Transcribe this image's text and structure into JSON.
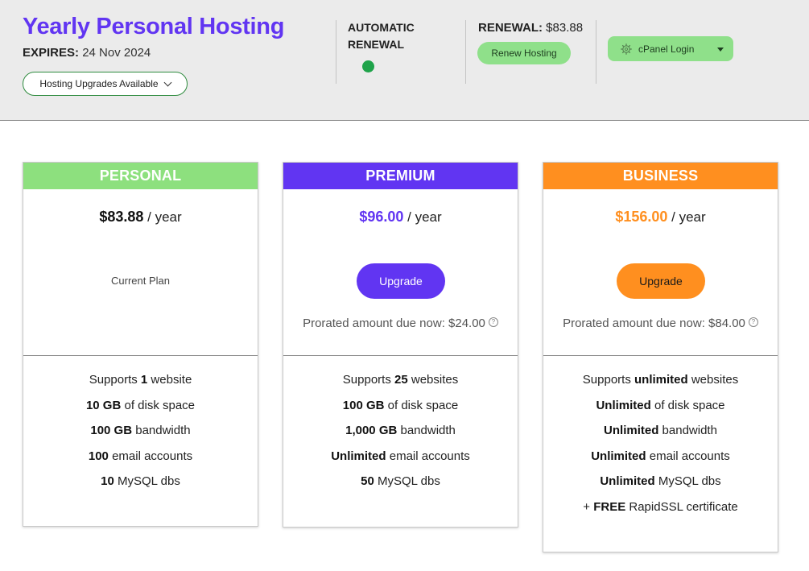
{
  "header": {
    "title": "Yearly Personal Hosting",
    "expires_label": "EXPIRES:",
    "expires_value": "24 Nov 2024",
    "upgrades_button": "Hosting Upgrades Available",
    "auto_renewal_label_1": "AUTOMATIC",
    "auto_renewal_label_2": "RENEWAL",
    "auto_renewal_status_color": "#1fa34a",
    "renewal_label": "RENEWAL:",
    "renewal_value": "$83.88",
    "renew_button": "Renew Hosting",
    "cpanel_button": "cPanel Login"
  },
  "plans": [
    {
      "name": "PERSONAL",
      "accent": "#8de07e",
      "price": "$83.88",
      "period": "/ year",
      "status": "Current Plan",
      "features": [
        {
          "pre": "Supports ",
          "bold": "1",
          "post": " website"
        },
        {
          "pre": "",
          "bold": "10 GB",
          "post": " of disk space"
        },
        {
          "pre": "",
          "bold": "100 GB",
          "post": " bandwidth"
        },
        {
          "pre": "",
          "bold": "100",
          "post": " email accounts"
        },
        {
          "pre": "",
          "bold": "10",
          "post": " MySQL dbs"
        }
      ]
    },
    {
      "name": "PREMIUM",
      "accent": "#6135f2",
      "price": "$96.00",
      "period": "/ year",
      "button": "Upgrade",
      "prorated": "Prorated amount due now: $24.00",
      "features": [
        {
          "pre": "Supports ",
          "bold": "25",
          "post": " websites"
        },
        {
          "pre": "",
          "bold": "100 GB",
          "post": " of disk space"
        },
        {
          "pre": "",
          "bold": "1,000 GB",
          "post": " bandwidth"
        },
        {
          "pre": "",
          "bold": "Unlimited",
          "post": " email accounts"
        },
        {
          "pre": "",
          "bold": "50",
          "post": " MySQL dbs"
        }
      ]
    },
    {
      "name": "BUSINESS",
      "accent": "#ff8f1f",
      "price": "$156.00",
      "period": "/ year",
      "button": "Upgrade",
      "prorated": "Prorated amount due now: $84.00",
      "features": [
        {
          "pre": "Supports ",
          "bold": "unlimited",
          "post": " websites"
        },
        {
          "pre": "",
          "bold": "Unlimited",
          "post": " of disk space"
        },
        {
          "pre": "",
          "bold": "Unlimited",
          "post": " bandwidth"
        },
        {
          "pre": "",
          "bold": "Unlimited",
          "post": " email accounts"
        },
        {
          "pre": "",
          "bold": "Unlimited",
          "post": " MySQL dbs"
        },
        {
          "pre": "+ ",
          "bold": "FREE",
          "post": " RapidSSL certificate"
        }
      ]
    }
  ],
  "icons": {
    "help": "?"
  }
}
